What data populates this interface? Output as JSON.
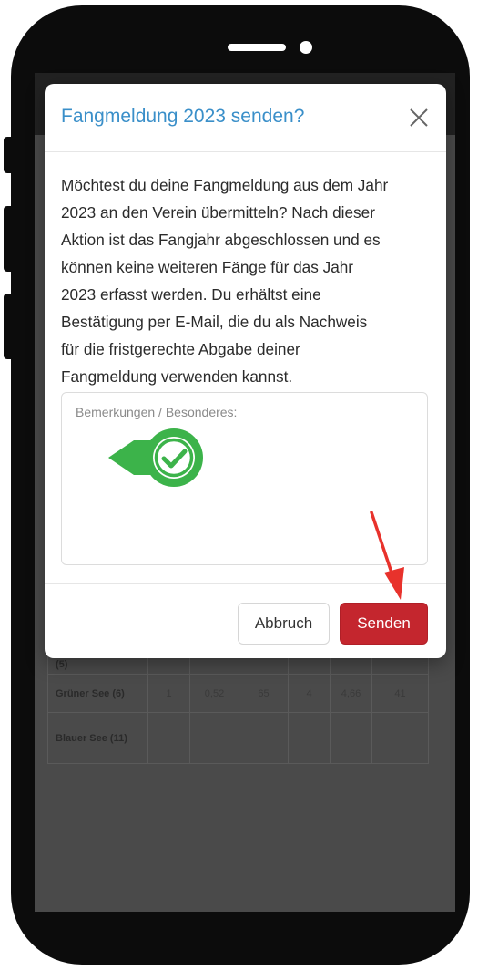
{
  "modal": {
    "title": "Fangmeldung 2023 senden?",
    "body_lines": [
      "Möchtest du deine Fangmeldung aus dem Jahr",
      "2023 an den Verein übermitteln? Nach dieser",
      "Aktion ist das Fangjahr abgeschlossen und es",
      "können keine weiteren Fänge für das Jahr",
      "2023 erfasst werden. Du erhältst eine",
      "Bestätigung per E-Mail, die du als Nachweis",
      "für die fristgerechte Abgabe deiner",
      "Fangmeldung verwenden kannst."
    ],
    "remarks_placeholder": "Bemerkungen / Besonderes:",
    "cancel_label": "Abbruch",
    "send_label": "Senden"
  },
  "icons": {
    "close": "close-icon",
    "check": "check-circle-icon",
    "arrow": "arrow-pointer-icon"
  },
  "colors": {
    "title": "#3a8fc9",
    "send_button": "#c4262e",
    "check_green": "#3cb34a",
    "arrow_red": "#e8322c"
  },
  "background_table": {
    "rows": [
      {
        "name": "(5)",
        "cells": [
          "",
          "",
          "",
          "",
          "",
          "",
          ""
        ]
      },
      {
        "name": "Grüner See (6)",
        "cells": [
          "1",
          "0,52",
          "65",
          "4",
          "4,66",
          "41",
          ""
        ]
      },
      {
        "name": "Blauer See (11)",
        "cells": [
          "",
          "",
          "",
          "",
          "",
          "",
          ""
        ]
      }
    ]
  }
}
